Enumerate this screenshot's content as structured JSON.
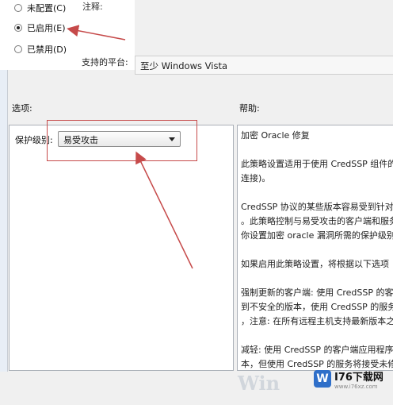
{
  "radios": [
    {
      "label": "未配置(C)",
      "checked": false
    },
    {
      "label": "已启用(E)",
      "checked": true
    },
    {
      "label": "已禁用(D)",
      "checked": false
    }
  ],
  "comment_label": "注释:",
  "platform": {
    "label": "支持的平台:",
    "value": "至少 Windows Vista"
  },
  "options_label": "选项:",
  "help_label": "帮助:",
  "protection": {
    "label": "保护级别:",
    "selected": "易受攻击"
  },
  "help_lines": [
    "加密 Oracle 修复",
    "",
    "此策略设置适用于使用 CredSSP 组件的",
    "连接)。",
    "",
    "CredSSP 协议的某些版本容易受到针对",
    "。此策略控制与易受攻击的客户端和服务",
    "你设置加密 oracle 漏洞所需的保护级别",
    "",
    "如果启用此策略设置，将根据以下选项",
    "",
    "强制更新的客户端: 使用 CredSSP 的客",
    "到不安全的版本，使用 CredSSP 的服务",
    "，注意: 在所有远程主机支持最新版本之",
    "",
    "减轻: 使用 CredSSP 的客户端应用程序",
    "本，但使用 CredSSP 的服务将接受未修",
    "修补客户端所造成的风险的重要信息，"
  ],
  "watermark": {
    "logo": "W",
    "title": "I76下载网",
    "url": "www.i76xz.com",
    "win_text": "Win"
  },
  "colors": {
    "annotation_red": "#c64a4a",
    "panel_border": "#aab0b8"
  }
}
